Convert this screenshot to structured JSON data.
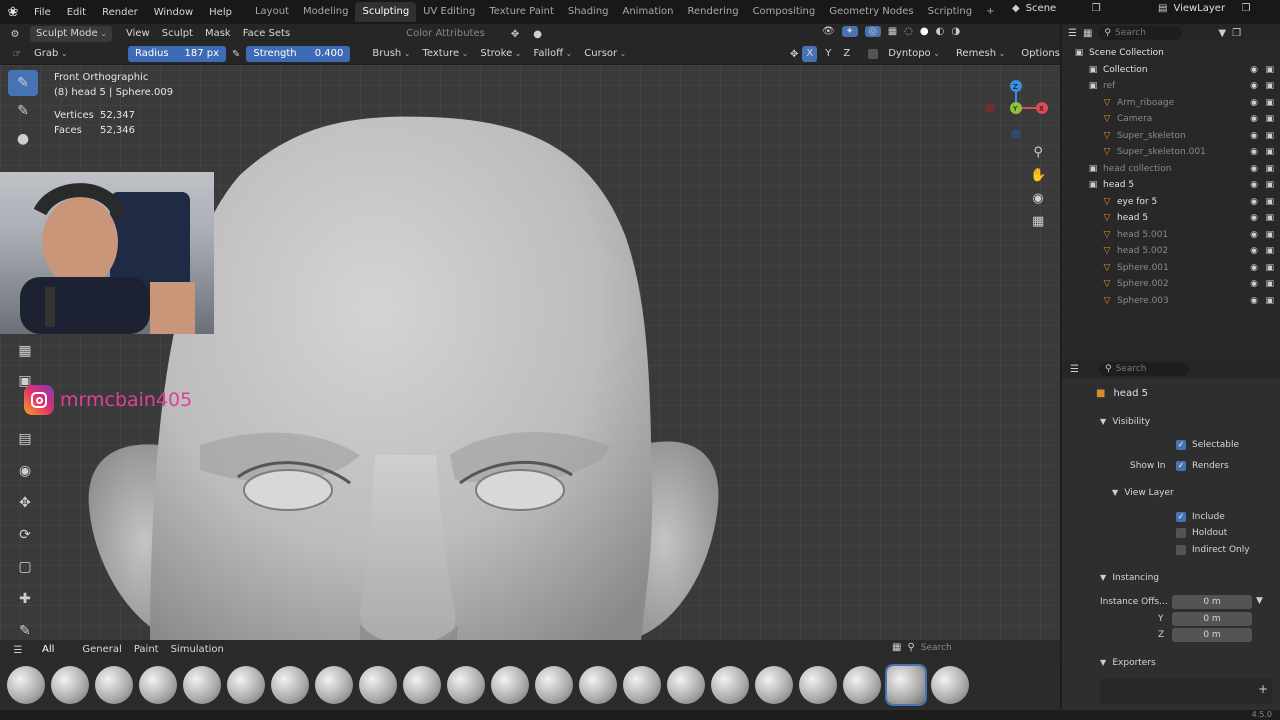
{
  "menubar": {
    "menus": [
      "File",
      "Edit",
      "Render",
      "Window",
      "Help"
    ],
    "workspaces": [
      "Layout",
      "Modeling",
      "Sculpting",
      "UV Editing",
      "Texture Paint",
      "Shading",
      "Animation",
      "Rendering",
      "Compositing",
      "Geometry Nodes",
      "Scripting"
    ],
    "active_workspace": "Sculpting",
    "scene": "Scene",
    "view_layer": "ViewLayer"
  },
  "header": {
    "mode": "Sculpt Mode",
    "menus": [
      "View",
      "Sculpt",
      "Mask",
      "Face Sets"
    ],
    "color_attributes": "Color Attributes"
  },
  "tool_settings": {
    "tool": "Grab",
    "radius_label": "Radius",
    "radius_value": "187 px",
    "strength_label": "Strength",
    "strength_value": "0.400",
    "menus": [
      "Brush",
      "Texture",
      "Stroke",
      "Falloff",
      "Cursor"
    ],
    "axes": [
      "X",
      "Y",
      "Z"
    ],
    "dyntopo": "Dyntopo",
    "remesh": "Remesh",
    "options": "Options"
  },
  "viewport": {
    "view_name": "Front Orthographic",
    "object_info": "(8) head 5 | Sphere.009",
    "stats": [
      {
        "label": "Vertices",
        "value": "52,347"
      },
      {
        "label": "Faces",
        "value": "52,346"
      }
    ],
    "gizmo_axes": [
      "Z",
      "Y",
      "X"
    ],
    "watermark": "mrmcbain405"
  },
  "brush_panel": {
    "tabs": [
      "All",
      "General",
      "Paint",
      "Simulation"
    ],
    "active_tab": "All",
    "search_placeholder": "Search"
  },
  "outliner": {
    "search_placeholder": "Search",
    "rows": [
      {
        "label": "Scene Collection",
        "depth": 0,
        "dim": false
      },
      {
        "label": "Collection",
        "depth": 1,
        "dim": false
      },
      {
        "label": "ref",
        "depth": 1,
        "dim": true
      },
      {
        "label": "Arm_riboage",
        "depth": 2,
        "dim": true
      },
      {
        "label": "Camera",
        "depth": 2,
        "dim": true
      },
      {
        "label": "Super_skeleton",
        "depth": 2,
        "dim": true
      },
      {
        "label": "Super_skeleton.001",
        "depth": 2,
        "dim": true
      },
      {
        "label": "head collection",
        "depth": 1,
        "dim": true
      },
      {
        "label": "head 5",
        "depth": 1,
        "dim": false
      },
      {
        "label": "eye for 5",
        "depth": 2,
        "dim": false
      },
      {
        "label": "head 5",
        "depth": 2,
        "dim": false
      },
      {
        "label": "head 5.001",
        "depth": 2,
        "dim": true
      },
      {
        "label": "head 5.002",
        "depth": 2,
        "dim": true
      },
      {
        "label": "Sphere.001",
        "depth": 2,
        "dim": true
      },
      {
        "label": "Sphere.002",
        "depth": 2,
        "dim": true
      },
      {
        "label": "Sphere.003",
        "depth": 2,
        "dim": true
      }
    ]
  },
  "properties": {
    "search_placeholder": "Search",
    "object_name": "head 5",
    "visibility": "Visibility",
    "selectable": "Selectable",
    "show_in": "Show In",
    "renders": "Renders",
    "view_layer": "View Layer",
    "include": "Include",
    "holdout": "Holdout",
    "indirect_only": "Indirect Only",
    "instancing": "Instancing",
    "instance_offset_label": "Instance Offs...",
    "instance_x": "0 m",
    "y_label": "Y",
    "instance_y": "0 m",
    "z_label": "Z",
    "instance_z": "0 m",
    "exporters": "Exporters"
  },
  "status": {
    "version": "4.5.0"
  },
  "colors": {
    "accent": "#4772b3",
    "active_tool": "#4772b3",
    "x_axis": "#d94a55",
    "y_axis": "#8ec03a",
    "z_axis": "#3d8de0",
    "instagram": "#e1306c"
  }
}
